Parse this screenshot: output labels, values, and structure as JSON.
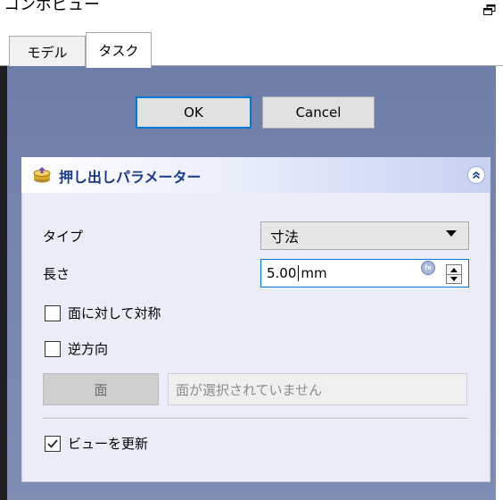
{
  "dock": {
    "title": "コンボビュー",
    "float_icon": "float-icon"
  },
  "tabs": [
    {
      "label": "モデル",
      "active": false
    },
    {
      "label": "タスク",
      "active": true
    }
  ],
  "dialog": {
    "ok_label": "OK",
    "cancel_label": "Cancel"
  },
  "panel": {
    "title": "押し出しパラメーター",
    "icon": "pad-icon",
    "collapse_icon": "collapse-icon",
    "type_label": "タイプ",
    "type_value": "寸法",
    "length_label": "長さ",
    "length_value": "5.00",
    "length_unit": "mm",
    "symmetric_label": "面に対して対称",
    "symmetric_checked": false,
    "reversed_label": "逆方向",
    "reversed_checked": false,
    "face_button_label": "面",
    "face_placeholder": "面が選択されていません",
    "update_view_label": "ビューを更新",
    "update_view_checked": true
  },
  "colors": {
    "accent": "#0078d7",
    "panel_bg": "#7584ad",
    "title_text": "#1a3a8e"
  }
}
